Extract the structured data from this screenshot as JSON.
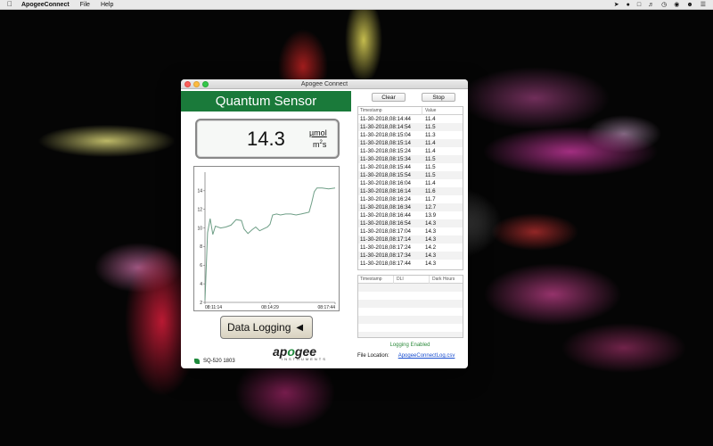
{
  "menubar": {
    "app_name": "ApogeeConnect",
    "menus": [
      "File",
      "Help"
    ],
    "status_icons": [
      "location-icon",
      "wifi-icon",
      "airplay-icon",
      "volume-icon",
      "clock-icon",
      "siri-icon",
      "user-icon",
      "list-icon"
    ]
  },
  "window": {
    "title": "Apogee Connect"
  },
  "sensor": {
    "header": "Quantum Sensor",
    "value": "14.3",
    "unit_top": "µmol",
    "unit_bottom_base": "m",
    "unit_bottom_sup": "2",
    "unit_bottom_tail": "s",
    "model": "SQ-520 1803"
  },
  "logging_button": {
    "label": "Data Logging",
    "arrow": "◀"
  },
  "logo": {
    "word_pre": "ap",
    "word_o": "o",
    "word_post": "gee",
    "sub": "INSTRUMENTS"
  },
  "controls": {
    "clear": "Clear",
    "stop": "Stop"
  },
  "table": {
    "headers": [
      "Timestamp",
      "Value"
    ],
    "rows": [
      [
        "11-30-2018,08:14:44",
        "11.4"
      ],
      [
        "11-30-2018,08:14:54",
        "11.5"
      ],
      [
        "11-30-2018,08:15:04",
        "11.3"
      ],
      [
        "11-30-2018,08:15:14",
        "11.4"
      ],
      [
        "11-30-2018,08:15:24",
        "11.4"
      ],
      [
        "11-30-2018,08:15:34",
        "11.5"
      ],
      [
        "11-30-2018,08:15:44",
        "11.5"
      ],
      [
        "11-30-2018,08:15:54",
        "11.5"
      ],
      [
        "11-30-2018,08:16:04",
        "11.4"
      ],
      [
        "11-30-2018,08:16:14",
        "11.6"
      ],
      [
        "11-30-2018,08:16:24",
        "11.7"
      ],
      [
        "11-30-2018,08:16:34",
        "12.7"
      ],
      [
        "11-30-2018,08:16:44",
        "13.9"
      ],
      [
        "11-30-2018,08:16:54",
        "14.3"
      ],
      [
        "11-30-2018,08:17:04",
        "14.3"
      ],
      [
        "11-30-2018,08:17:14",
        "14.3"
      ],
      [
        "11-30-2018,08:17:24",
        "14.2"
      ],
      [
        "11-30-2018,08:17:34",
        "14.3"
      ],
      [
        "11-30-2018,08:17:44",
        "14.3"
      ]
    ]
  },
  "dli_table": {
    "headers": [
      "Timestamp",
      "DLI",
      "Dark Hours"
    ]
  },
  "status": {
    "logging": "Logging Enabled",
    "file_label": "File Location:",
    "file_name": "ApogeeConnectLog.csv"
  },
  "chart_data": {
    "type": "line",
    "ylim": [
      2,
      16
    ],
    "yticks": [
      2,
      4,
      6,
      8,
      10,
      12,
      14
    ],
    "x_tick_labels": [
      "08:11:14",
      "08:14:29",
      "08:17:44"
    ],
    "series": [
      {
        "color": "#6e9e86",
        "x": [
          0,
          0.02,
          0.04,
          0.06,
          0.08,
          0.12,
          0.16,
          0.2,
          0.24,
          0.28,
          0.3,
          0.33,
          0.36,
          0.39,
          0.42,
          0.45,
          0.48,
          0.5,
          0.52,
          0.55,
          0.58,
          0.62,
          0.66,
          0.7,
          0.74,
          0.77,
          0.8,
          0.82,
          0.84,
          0.86,
          0.9,
          0.95,
          1.0
        ],
        "y": [
          2.2,
          9.5,
          11.0,
          9.3,
          10.2,
          10.0,
          10.1,
          10.3,
          10.9,
          10.8,
          9.9,
          9.4,
          9.8,
          10.1,
          9.7,
          9.9,
          10.1,
          10.4,
          11.4,
          11.5,
          11.4,
          11.5,
          11.5,
          11.4,
          11.5,
          11.6,
          11.7,
          12.7,
          13.9,
          14.3,
          14.3,
          14.2,
          14.3
        ]
      }
    ]
  },
  "colors": {
    "header_green": "#1a7a3a",
    "link_blue": "#1a4fd0",
    "status_green": "#2e8b3d"
  }
}
